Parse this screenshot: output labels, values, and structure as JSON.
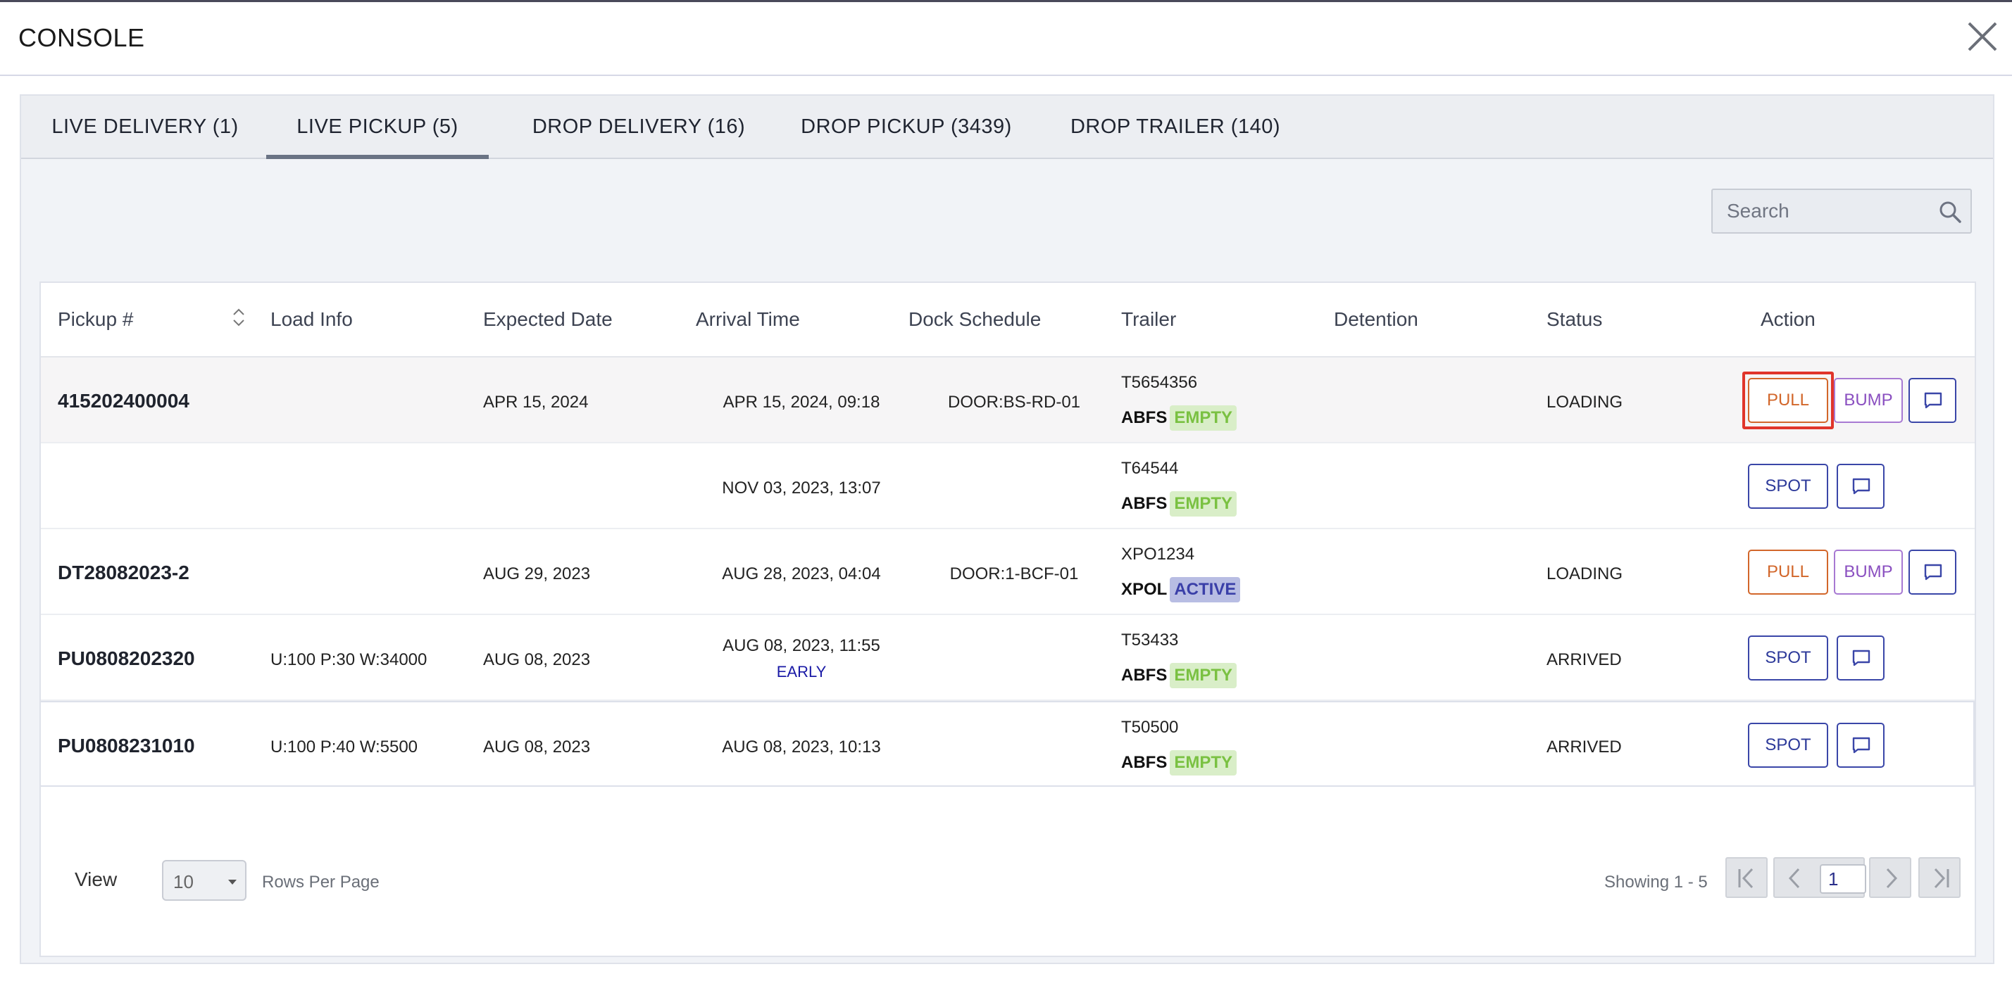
{
  "window": {
    "title": "CONSOLE"
  },
  "tabs": [
    {
      "label": "LIVE DELIVERY (1)",
      "active": false
    },
    {
      "label": "LIVE PICKUP (5)",
      "active": true
    },
    {
      "label": "DROP DELIVERY (16)",
      "active": false
    },
    {
      "label": "DROP PICKUP (3439)",
      "active": false
    },
    {
      "label": "DROP TRAILER (140)",
      "active": false
    }
  ],
  "search": {
    "placeholder": "Search"
  },
  "table": {
    "headers": [
      "Pickup #",
      "Load Info",
      "Expected Date",
      "Arrival Time",
      "Dock Schedule",
      "Trailer",
      "Detention",
      "Status",
      "Action"
    ],
    "rows": [
      {
        "pickup": "415202400004",
        "load_info": "",
        "expected": "APR 15, 2024",
        "arrival": "APR 15, 2024, 09:18",
        "arrival_note": "",
        "dock": "DOOR:BS-RD-01",
        "trailer": "T5654356",
        "carrier": "ABFS",
        "trailer_state": "EMPTY",
        "detention": "",
        "status": "LOADING",
        "actions": [
          "PULL",
          "BUMP"
        ]
      },
      {
        "pickup": "",
        "load_info": "",
        "expected": "",
        "arrival": "NOV 03, 2023, 13:07",
        "arrival_note": "",
        "dock": "",
        "trailer": "T64544",
        "carrier": "ABFS",
        "trailer_state": "EMPTY",
        "detention": "",
        "status": "",
        "actions": [
          "SPOT"
        ]
      },
      {
        "pickup": "DT28082023-2",
        "load_info": "",
        "expected": "AUG 29, 2023",
        "arrival": "AUG 28, 2023, 04:04",
        "arrival_note": "",
        "dock": "DOOR:1-BCF-01",
        "trailer": "XPO1234",
        "carrier": "XPOL",
        "trailer_state": "ACTIVE",
        "detention": "",
        "status": "LOADING",
        "actions": [
          "PULL",
          "BUMP"
        ]
      },
      {
        "pickup": "PU0808202320",
        "load_info": "U:100 P:30 W:34000",
        "expected": "AUG 08, 2023",
        "arrival": "AUG 08, 2023, 11:55",
        "arrival_note": "EARLY",
        "dock": "",
        "trailer": "T53433",
        "carrier": "ABFS",
        "trailer_state": "EMPTY",
        "detention": "",
        "status": "ARRIVED",
        "actions": [
          "SPOT"
        ]
      },
      {
        "pickup": "PU0808231010",
        "load_info": "U:100 P:40 W:5500",
        "expected": "AUG 08, 2023",
        "arrival": "AUG 08, 2023, 10:13",
        "arrival_note": "",
        "dock": "",
        "trailer": "T50500",
        "carrier": "ABFS",
        "trailer_state": "EMPTY",
        "detention": "",
        "status": "ARRIVED",
        "actions": [
          "SPOT"
        ]
      }
    ]
  },
  "footer": {
    "view_label": "View",
    "rows_per_page_value": "10",
    "rows_per_page_label": "Rows Per Page",
    "showing": "Showing 1 - 5",
    "page": "1"
  },
  "colors": {
    "pull": "#d2662a",
    "bump": "#8a4fc0",
    "spot": "#2d3a9a",
    "empty_badge": "#7ac142",
    "active_badge": "#3a3fa8",
    "focus": "#e0352b"
  },
  "icons": {
    "close": "close-icon",
    "search": "search-icon",
    "sort": "sort-icon",
    "message": "message-icon"
  }
}
